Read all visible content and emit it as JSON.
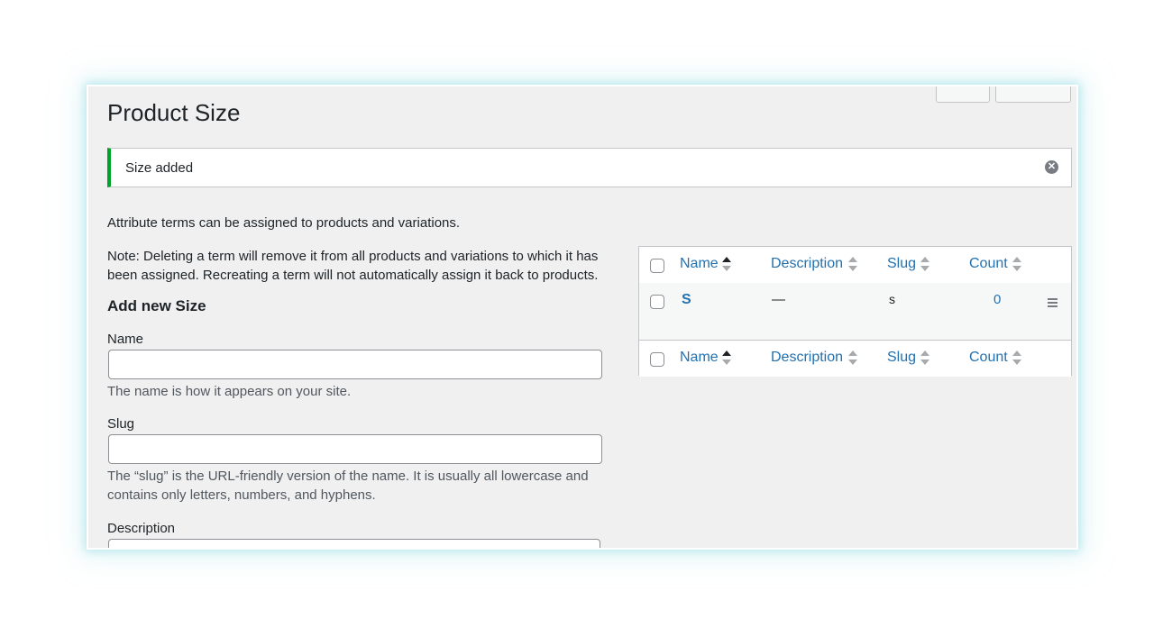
{
  "page": {
    "title": "Product Size"
  },
  "notice": {
    "text": "Size added",
    "status_color": "#00a32a"
  },
  "intro": "Attribute terms can be assigned to products and variations.",
  "note": "Note: Deleting a term will remove it from all products and variations to which it has been assigned. Recreating a term will not automatically assign it back to products.",
  "form": {
    "title": "Add new Size",
    "name_label": "Name",
    "name_value": "",
    "name_help": "The name is how it appears on your site.",
    "slug_label": "Slug",
    "slug_value": "",
    "slug_help": "The “slug” is the URL-friendly version of the name. It is usually all lowercase and contains only letters, numbers, and hyphens.",
    "description_label": "Description",
    "description_value": ""
  },
  "table": {
    "columns": [
      "Name",
      "Description",
      "Slug",
      "Count"
    ],
    "sorted_column": "Name",
    "rows": [
      {
        "name": "S",
        "description": "—",
        "slug": "s",
        "count": "0"
      }
    ],
    "icons": [
      "sort-arrows-icon",
      "drag-handle-icon",
      "dismiss-icon"
    ]
  }
}
